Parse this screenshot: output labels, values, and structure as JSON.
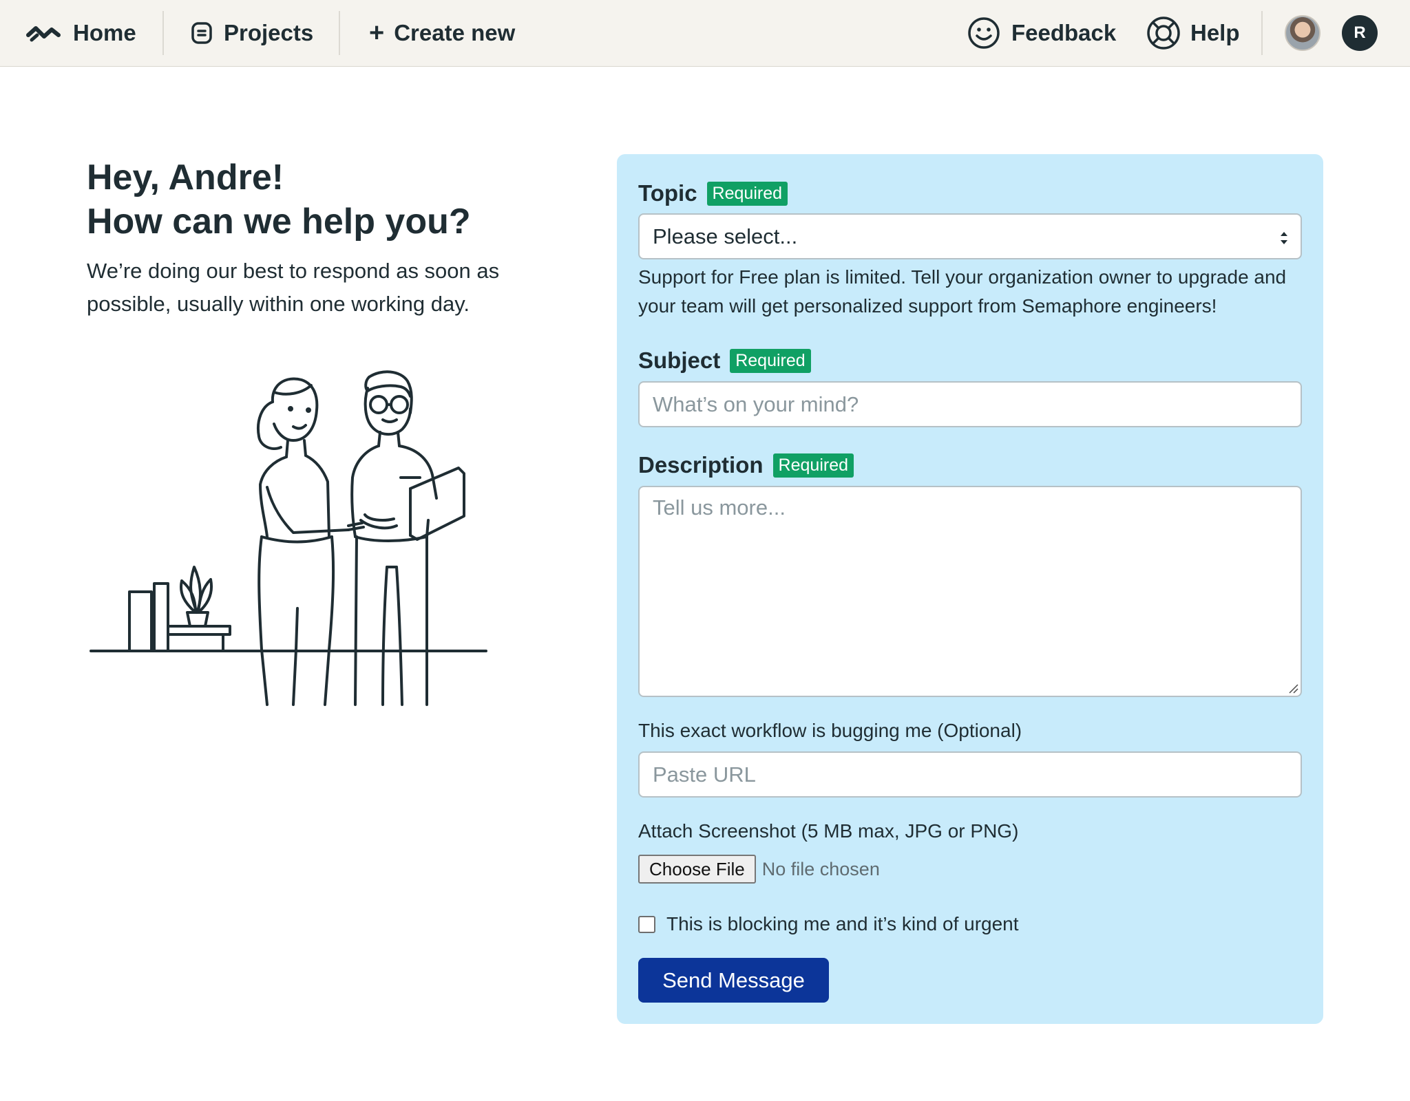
{
  "nav": {
    "home_label": "Home",
    "projects_label": "Projects",
    "create_label": "Create new",
    "feedback_label": "Feedback",
    "help_label": "Help",
    "user_initial": "R"
  },
  "greeting": {
    "title_line1": "Hey, Andre!",
    "title_line2": "How can we help you?",
    "subtitle": "We’re doing our best to respond as soon as possible, usually within one working day."
  },
  "form": {
    "topic": {
      "label": "Topic",
      "required_badge": "Required",
      "selected_value": "Please select...",
      "help_text": "Support for Free plan is limited. Tell your organization owner to upgrade and your team will get personalized support from Semaphore engineers!"
    },
    "subject": {
      "label": "Subject",
      "required_badge": "Required",
      "placeholder": "What’s on your mind?"
    },
    "description": {
      "label": "Description",
      "required_badge": "Required",
      "placeholder": "Tell us more..."
    },
    "workflow": {
      "label": "This exact workflow is bugging me (Optional)",
      "placeholder": "Paste URL"
    },
    "attachment": {
      "label": "Attach Screenshot (5 MB max, JPG or PNG)",
      "button_label": "Choose File",
      "status": "No file chosen"
    },
    "urgent": {
      "label": "This is blocking me and it’s kind of urgent",
      "checked": false
    },
    "submit_label": "Send Message"
  },
  "colors": {
    "nav_background": "#f5f3ee",
    "panel_background": "#c8ebfb",
    "required_badge": "#10a064",
    "primary_button": "#0c3599",
    "text": "#1f2d33"
  },
  "icons": {
    "home": "semaphore-logo-icon",
    "projects": "projects-icon",
    "create": "plus-icon",
    "feedback": "smiley-icon",
    "help": "lifebuoy-icon"
  }
}
